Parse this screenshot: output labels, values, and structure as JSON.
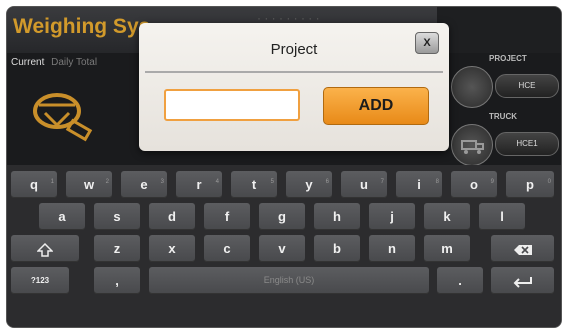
{
  "app": {
    "title": "Weighing Sys",
    "tabs": [
      "Current",
      "Daily Total"
    ],
    "project_label": "PROJECT",
    "project_value": "HCE",
    "truck_label": "TRUCK",
    "truck_value": "HCE1"
  },
  "dialog": {
    "title": "Project",
    "close_label": "X",
    "input_value": "",
    "add_label": "ADD"
  },
  "keyboard": {
    "row1": [
      {
        "key": "q",
        "alt": "1"
      },
      {
        "key": "w",
        "alt": "2"
      },
      {
        "key": "e",
        "alt": "3"
      },
      {
        "key": "r",
        "alt": "4"
      },
      {
        "key": "t",
        "alt": "5"
      },
      {
        "key": "y",
        "alt": "6"
      },
      {
        "key": "u",
        "alt": "7"
      },
      {
        "key": "i",
        "alt": "8"
      },
      {
        "key": "o",
        "alt": "9"
      },
      {
        "key": "p",
        "alt": "0"
      }
    ],
    "row2": [
      "a",
      "s",
      "d",
      "f",
      "g",
      "h",
      "j",
      "k",
      "l"
    ],
    "row3": [
      "z",
      "x",
      "c",
      "v",
      "b",
      "n",
      "m"
    ],
    "shift_icon": "shift-icon",
    "backspace_icon": "backspace-icon",
    "sym_label": "?123",
    "comma_label": ",",
    "space_label": "English (US)",
    "period_label": ".",
    "enter_icon": "enter-icon"
  },
  "colors": {
    "accent": "#f0a040",
    "title_gold": "#d29a2b"
  }
}
